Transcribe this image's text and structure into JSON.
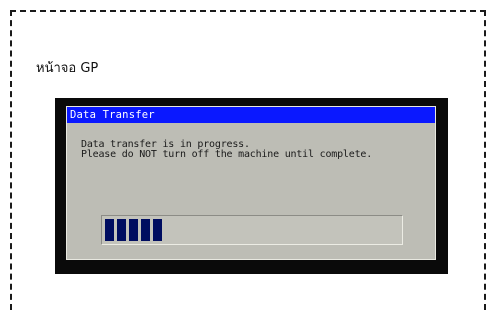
{
  "caption": "หน้าจอ GP",
  "dialog": {
    "title": "Data Transfer",
    "message_lines": [
      "Data transfer is in progress.",
      "Please do NOT turn off the machine until complete."
    ]
  },
  "progress": {
    "percent": 20,
    "segments_filled": 5
  },
  "colors": {
    "titlebar": "#0a18ff",
    "dialog_bg": "#bdbdb5",
    "progress_fill": "#000d60",
    "bezel": "#0a0a0a"
  }
}
